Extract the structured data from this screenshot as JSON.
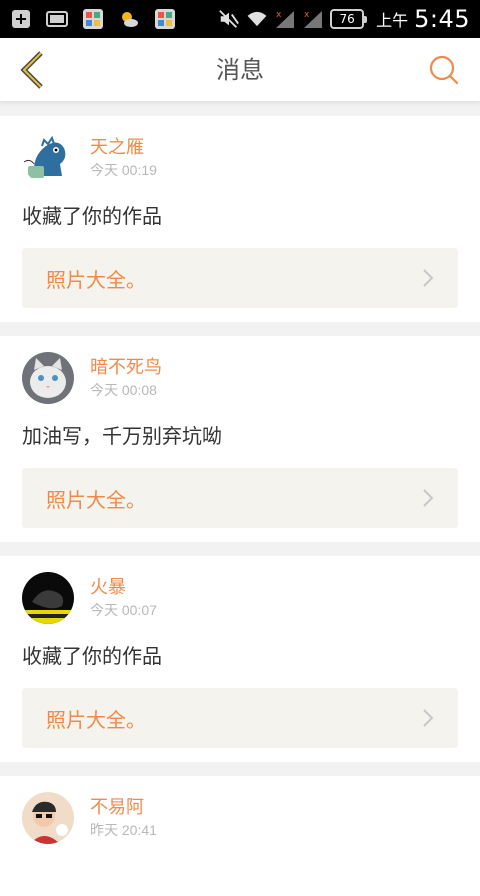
{
  "status_bar": {
    "battery": "76",
    "ampm": "上午",
    "time": "5:45"
  },
  "nav": {
    "title": "消息",
    "accent": "#f08a4b"
  },
  "messages": [
    {
      "username": "天之雁",
      "time": "今天 00:19",
      "text": "收藏了你的作品",
      "work_title": "照片大全。",
      "avatar": "dinosaur-avatar"
    },
    {
      "username": "暗不死鸟",
      "time": "今天 00:08",
      "text": "加油写，千万别弃坑呦",
      "work_title": "照片大全。",
      "avatar": "white-cat-avatar"
    },
    {
      "username": "火暴",
      "time": "今天 00:07",
      "text": "收藏了你的作品",
      "work_title": "照片大全。",
      "avatar": "dark-photo-avatar"
    },
    {
      "username": "不易阿",
      "time": "昨天 20:41",
      "text": "",
      "work_title": "",
      "avatar": "person-avatar"
    }
  ]
}
